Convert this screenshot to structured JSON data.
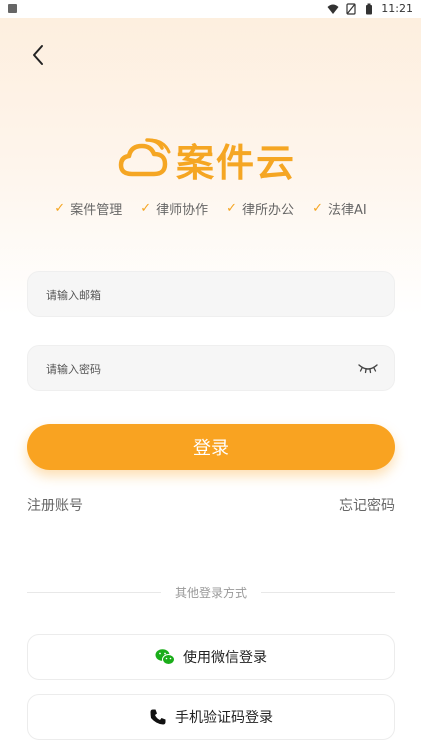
{
  "status": {
    "time": "11:21"
  },
  "brand": {
    "name": "案件云",
    "primary": "#f5a623"
  },
  "features": [
    "案件管理",
    "律师协作",
    "律所办公",
    "法律AI"
  ],
  "form": {
    "email_placeholder": "请输入邮箱",
    "password_placeholder": "请输入密码"
  },
  "actions": {
    "login_label": "登录",
    "register_label": "注册账号",
    "forgot_label": "忘记密码"
  },
  "other": {
    "divider_label": "其他登录方式",
    "wechat_label": "使用微信登录",
    "phone_label": "手机验证码登录"
  }
}
